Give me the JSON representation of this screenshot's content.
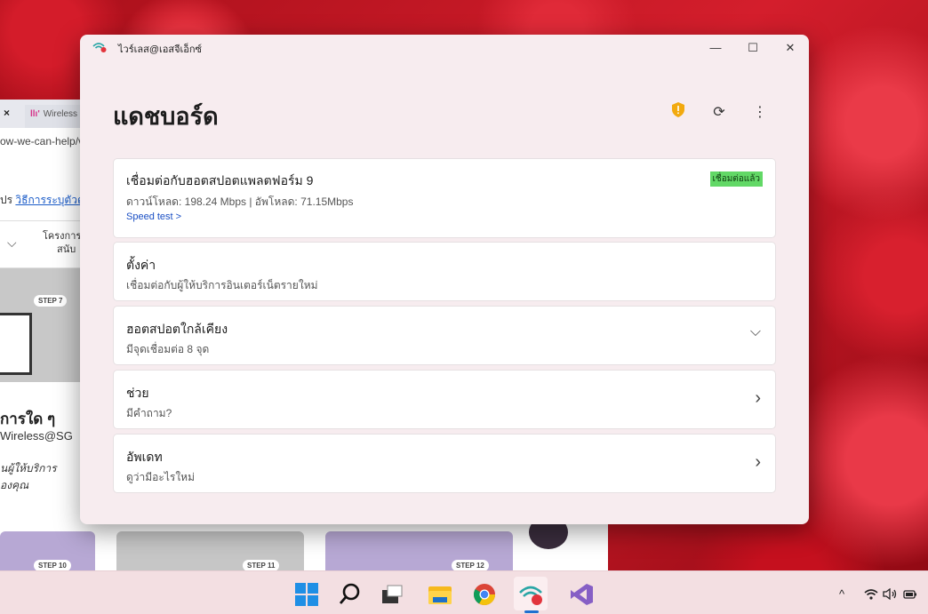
{
  "browser": {
    "tab_close": "×",
    "tab_label": "Wireless",
    "tab_logo": "llı'",
    "url_fragment": "ow-we-can-help/v",
    "link_prefix": "ปร ",
    "link_text": "วิธีการระบุตัวตน",
    "nav_line1": "โครงการ",
    "nav_line2": "สนับ",
    "step7": "STEP 7",
    "heading": "การใด ๆ",
    "subtitle": "Wireless@SG",
    "italic1": "นผู้ให้บริการ",
    "italic2": "องคุณ",
    "step10": "STEP 10",
    "step11": "STEP 11",
    "step12": "STEP 12"
  },
  "window": {
    "app_title": "ไวร์เลส@เอสจีเอ็กซ์",
    "controls": {
      "minimize": "—",
      "maximize": "☐",
      "close": "✕"
    }
  },
  "dashboard": {
    "title": "แดชบอร์ด",
    "icons": [
      "shield-icon",
      "refresh-icon",
      "more-vertical-icon"
    ],
    "connection": {
      "title": "เชื่อมต่อกับฮอตสปอตแพลตฟอร์ม 9",
      "speeds": "ดาวน์โหลด: 198.24 Mbps | อัพโหลด: 71.15Mbps",
      "speed_test": "Speed test >",
      "status": "เชื่อมต่อแล้ว"
    },
    "cards": [
      {
        "title": "ตั้งค่า",
        "sub": "เชื่อมต่อกับผู้ให้บริการอินเตอร์เน็ตรายใหม่"
      },
      {
        "title": "ฮอตสปอตใกล้เคียง",
        "sub": "มีจุดเชื่อมต่อ 8 จุด",
        "chevron": "⌵"
      },
      {
        "title": "ช่วย",
        "sub": "มีคำถาม?",
        "chevron": "›"
      },
      {
        "title": "อัพเดท",
        "sub": "ดูว่ามีอะไรใหม่",
        "chevron": "›"
      }
    ]
  },
  "taskbar": {
    "apps": [
      "windows-start-icon",
      "search-icon",
      "task-view-icon",
      "file-explorer-icon",
      "chrome-icon",
      "wireless-sgx-icon",
      "visual-studio-icon"
    ],
    "tray": {
      "chevron": "^",
      "wifi": "wifi-icon",
      "volume": "volume-icon",
      "battery": "battery-icon"
    }
  },
  "colors": {
    "window_bg": "#f7ecef",
    "badge_green": "#62d866",
    "link_blue": "#1a4fc4",
    "shield_orange": "#f2a90e",
    "taskbar_bg": "#f3dfe2"
  }
}
